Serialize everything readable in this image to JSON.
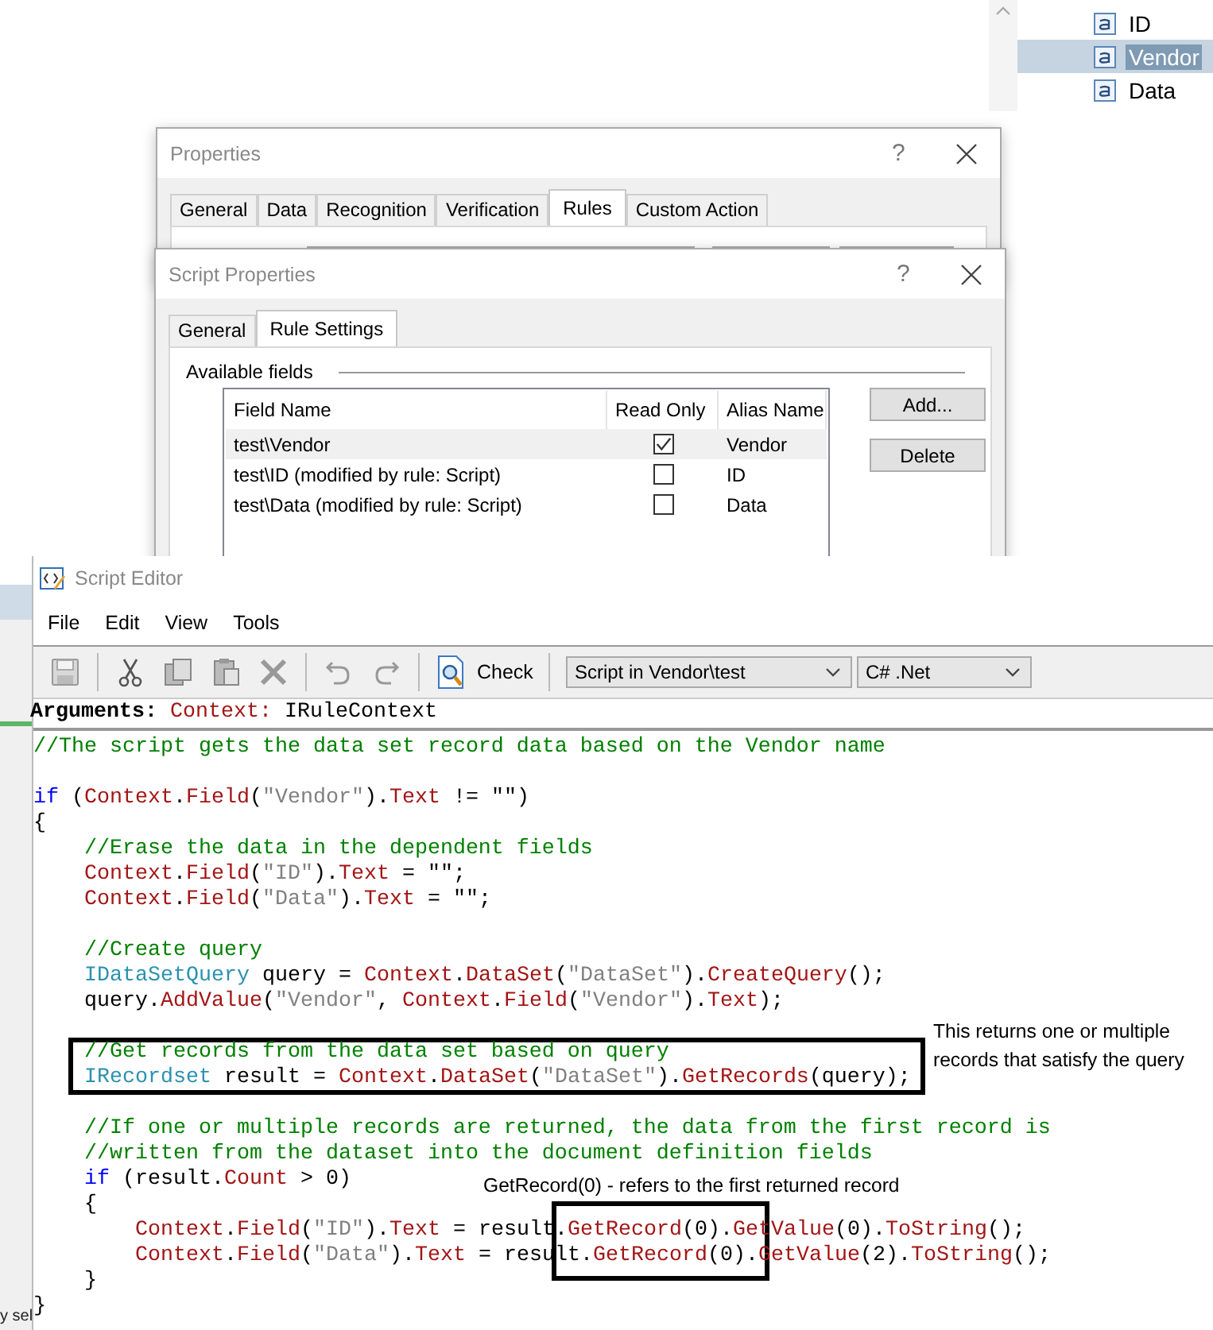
{
  "background_tree": {
    "items": [
      {
        "label": "ID",
        "selected": false
      },
      {
        "label": "Vendor",
        "selected": true
      },
      {
        "label": "Data",
        "selected": false
      }
    ]
  },
  "background_panel": {
    "text": "y sel"
  },
  "properties_window": {
    "title": "Properties",
    "help": "?",
    "tabs": [
      {
        "label": "General",
        "selected": false
      },
      {
        "label": "Data",
        "selected": false
      },
      {
        "label": "Recognition",
        "selected": false
      },
      {
        "label": "Verification",
        "selected": false
      },
      {
        "label": "Rules",
        "selected": true
      },
      {
        "label": "Custom Action",
        "selected": false
      }
    ]
  },
  "script_properties_window": {
    "title": "Script Properties",
    "help": "?",
    "tabs": [
      {
        "label": "General",
        "selected": false
      },
      {
        "label": "Rule Settings",
        "selected": true
      }
    ],
    "group_label": "Available fields",
    "table": {
      "columns": [
        "Field Name",
        "Read Only",
        "Alias Name"
      ],
      "rows": [
        {
          "field_name": "test\\Vendor",
          "read_only": true,
          "alias_name": "Vendor",
          "selected": true
        },
        {
          "field_name": "test\\ID (modified by rule: Script)",
          "read_only": false,
          "alias_name": "ID",
          "selected": false
        },
        {
          "field_name": "test\\Data (modified by rule: Script)",
          "read_only": false,
          "alias_name": "Data",
          "selected": false
        }
      ]
    },
    "buttons": [
      "Add...",
      "Delete"
    ]
  },
  "script_editor": {
    "title": "Script Editor",
    "menu": [
      "File",
      "Edit",
      "View",
      "Tools"
    ],
    "toolbar": {
      "check_label": "Check",
      "script_select": "Script in Vendor\\test",
      "language_select": "C# .Net"
    },
    "arguments": [
      {
        "kind": "label",
        "text": "Arguments: "
      },
      {
        "kind": "member",
        "text": "Context:"
      },
      {
        "kind": "plain",
        "text": " IRuleContext"
      }
    ],
    "code_lines": [
      {
        "kind": "code",
        "tokens": [
          {
            "kind": "comment",
            "text": "//The script gets the data set record data based on the Vendor name"
          }
        ]
      },
      {
        "kind": "blank"
      },
      {
        "kind": "code",
        "tokens": [
          {
            "kind": "keyword",
            "text": "if"
          },
          {
            "kind": "plain",
            "text": " ("
          },
          {
            "kind": "member",
            "text": "Context"
          },
          {
            "kind": "plain",
            "text": "."
          },
          {
            "kind": "member",
            "text": "Field"
          },
          {
            "kind": "plain",
            "text": "("
          },
          {
            "kind": "string",
            "text": "\"Vendor\""
          },
          {
            "kind": "plain",
            "text": ")."
          },
          {
            "kind": "member",
            "text": "Text"
          },
          {
            "kind": "plain",
            "text": " != \"\")"
          }
        ]
      },
      {
        "kind": "code",
        "tokens": [
          {
            "kind": "plain",
            "text": "{"
          }
        ]
      },
      {
        "kind": "code",
        "tokens": [
          {
            "kind": "comment",
            "text": "    //Erase the data in the dependent fields"
          }
        ]
      },
      {
        "kind": "code",
        "tokens": [
          {
            "kind": "member",
            "text": "    Context"
          },
          {
            "kind": "plain",
            "text": "."
          },
          {
            "kind": "member",
            "text": "Field"
          },
          {
            "kind": "plain",
            "text": "("
          },
          {
            "kind": "string",
            "text": "\"ID\""
          },
          {
            "kind": "plain",
            "text": ")."
          },
          {
            "kind": "member",
            "text": "Text"
          },
          {
            "kind": "plain",
            "text": " = \"\";"
          }
        ]
      },
      {
        "kind": "code",
        "tokens": [
          {
            "kind": "member",
            "text": "    Context"
          },
          {
            "kind": "plain",
            "text": "."
          },
          {
            "kind": "member",
            "text": "Field"
          },
          {
            "kind": "plain",
            "text": "("
          },
          {
            "kind": "string",
            "text": "\"Data\""
          },
          {
            "kind": "plain",
            "text": ")."
          },
          {
            "kind": "member",
            "text": "Text"
          },
          {
            "kind": "plain",
            "text": " = \"\";"
          }
        ]
      },
      {
        "kind": "blank"
      },
      {
        "kind": "code",
        "tokens": [
          {
            "kind": "comment",
            "text": "    //Create query"
          }
        ]
      },
      {
        "kind": "code",
        "tokens": [
          {
            "kind": "type",
            "text": "    IDataSetQuery"
          },
          {
            "kind": "plain",
            "text": " query = "
          },
          {
            "kind": "member",
            "text": "Context"
          },
          {
            "kind": "plain",
            "text": "."
          },
          {
            "kind": "member",
            "text": "DataSet"
          },
          {
            "kind": "plain",
            "text": "("
          },
          {
            "kind": "string",
            "text": "\"DataSet\""
          },
          {
            "kind": "plain",
            "text": ")."
          },
          {
            "kind": "member",
            "text": "CreateQuery"
          },
          {
            "kind": "plain",
            "text": "();"
          }
        ]
      },
      {
        "kind": "code",
        "tokens": [
          {
            "kind": "plain",
            "text": "    query."
          },
          {
            "kind": "member",
            "text": "AddValue"
          },
          {
            "kind": "plain",
            "text": "("
          },
          {
            "kind": "string",
            "text": "\"Vendor\""
          },
          {
            "kind": "plain",
            "text": ", "
          },
          {
            "kind": "member",
            "text": "Context"
          },
          {
            "kind": "plain",
            "text": "."
          },
          {
            "kind": "member",
            "text": "Field"
          },
          {
            "kind": "plain",
            "text": "("
          },
          {
            "kind": "string",
            "text": "\"Vendor\""
          },
          {
            "kind": "plain",
            "text": ")."
          },
          {
            "kind": "member",
            "text": "Text"
          },
          {
            "kind": "plain",
            "text": ");"
          }
        ]
      },
      {
        "kind": "blank"
      },
      {
        "kind": "code",
        "tokens": [
          {
            "kind": "comment",
            "text": "    //Get records from the data set based on query"
          }
        ]
      },
      {
        "kind": "code",
        "tokens": [
          {
            "kind": "type",
            "text": "    IRecordset"
          },
          {
            "kind": "plain",
            "text": " result = "
          },
          {
            "kind": "member",
            "text": "Context"
          },
          {
            "kind": "plain",
            "text": "."
          },
          {
            "kind": "member",
            "text": "DataSet"
          },
          {
            "kind": "plain",
            "text": "("
          },
          {
            "kind": "string",
            "text": "\"DataSet\""
          },
          {
            "kind": "plain",
            "text": ")."
          },
          {
            "kind": "member",
            "text": "GetRecords"
          },
          {
            "kind": "plain",
            "text": "(query);"
          }
        ]
      },
      {
        "kind": "blank"
      },
      {
        "kind": "code",
        "tokens": [
          {
            "kind": "comment",
            "text": "    //If one or multiple records are returned, the data from the first record is"
          }
        ]
      },
      {
        "kind": "code",
        "tokens": [
          {
            "kind": "comment",
            "text": "    //written from the dataset into the document definition fields"
          }
        ]
      },
      {
        "kind": "code",
        "tokens": [
          {
            "kind": "keyword",
            "text": "    if"
          },
          {
            "kind": "plain",
            "text": " (result."
          },
          {
            "kind": "member",
            "text": "Count"
          },
          {
            "kind": "plain",
            "text": " > 0)"
          }
        ]
      },
      {
        "kind": "code",
        "tokens": [
          {
            "kind": "plain",
            "text": "    {"
          }
        ]
      },
      {
        "kind": "code",
        "tokens": [
          {
            "kind": "member",
            "text": "        Context"
          },
          {
            "kind": "plain",
            "text": "."
          },
          {
            "kind": "member",
            "text": "Field"
          },
          {
            "kind": "plain",
            "text": "("
          },
          {
            "kind": "string",
            "text": "\"ID\""
          },
          {
            "kind": "plain",
            "text": ")."
          },
          {
            "kind": "member",
            "text": "Text"
          },
          {
            "kind": "plain",
            "text": " = result."
          },
          {
            "kind": "member",
            "text": "GetRecord"
          },
          {
            "kind": "plain",
            "text": "(0)."
          },
          {
            "kind": "member",
            "text": "GetValue"
          },
          {
            "kind": "plain",
            "text": "(0)."
          },
          {
            "kind": "member",
            "text": "ToString"
          },
          {
            "kind": "plain",
            "text": "();"
          }
        ]
      },
      {
        "kind": "code",
        "tokens": [
          {
            "kind": "member",
            "text": "        Context"
          },
          {
            "kind": "plain",
            "text": "."
          },
          {
            "kind": "member",
            "text": "Field"
          },
          {
            "kind": "plain",
            "text": "("
          },
          {
            "kind": "string",
            "text": "\"Data\""
          },
          {
            "kind": "plain",
            "text": ")."
          },
          {
            "kind": "member",
            "text": "Text"
          },
          {
            "kind": "plain",
            "text": " = result."
          },
          {
            "kind": "member",
            "text": "GetRecord"
          },
          {
            "kind": "plain",
            "text": "(0)."
          },
          {
            "kind": "member",
            "text": "GetValue"
          },
          {
            "kind": "plain",
            "text": "(2)."
          },
          {
            "kind": "member",
            "text": "ToString"
          },
          {
            "kind": "plain",
            "text": "();"
          }
        ]
      },
      {
        "kind": "code",
        "tokens": [
          {
            "kind": "plain",
            "text": "    }"
          }
        ]
      },
      {
        "kind": "code",
        "tokens": [
          {
            "kind": "plain",
            "text": "}"
          }
        ]
      }
    ]
  },
  "annotations": [
    {
      "text": "This returns one or multiple records that satisfy the query"
    },
    {
      "text": "GetRecord(0) - refers to the first returned record"
    }
  ]
}
